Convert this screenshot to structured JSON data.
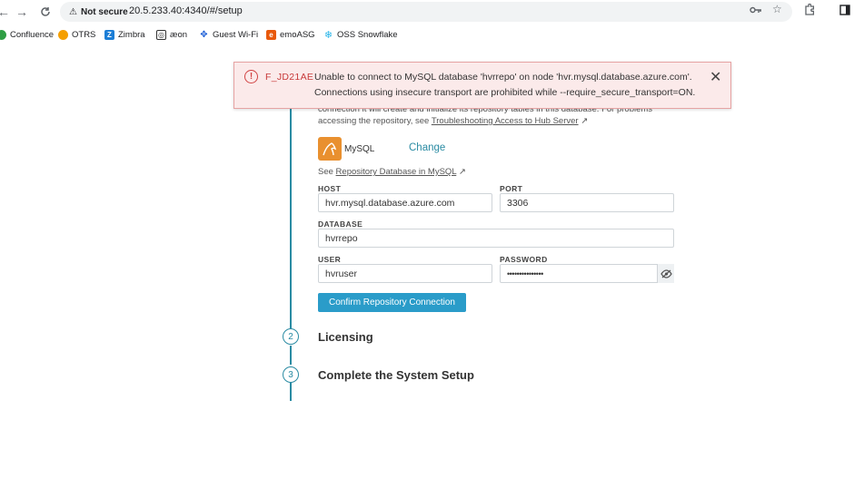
{
  "browser": {
    "not_secure_label": "Not secure",
    "url": "20.5.233.40:4340/#/setup"
  },
  "bookmarks": [
    {
      "label": "Confluence",
      "color": "#2f9e44"
    },
    {
      "label": "OTRS",
      "color": "#f59f00"
    },
    {
      "label": "Zimbra",
      "color": "#1c7ed6"
    },
    {
      "label": "æon",
      "color": "#333333"
    },
    {
      "label": "Guest Wi-Fi",
      "color": "#1c5ed6"
    },
    {
      "label": "emoASG",
      "color": "#e8590c"
    },
    {
      "label": "OSS Snowflake",
      "color": "#29b5e8"
    }
  ],
  "error": {
    "code": "F_JD21AE",
    "line1": "Unable to connect to MySQL database 'hvrrepo' on node 'hvr.mysql.database.azure.com'.",
    "line2": "Connections using insecure transport are prohibited while --require_secure_transport=ON."
  },
  "repository": {
    "description_line1": "connection it will create and initialize its repository tables in this database. For problems",
    "description_prefix": "accessing the repository, see ",
    "troubleshoot_link": "Troubleshooting Access to Hub Server",
    "db_type": "MySQL",
    "change_label": "Change",
    "see_prefix": "See ",
    "repo_db_link": "Repository Database in MySQL",
    "host_label": "HOST",
    "host_value": "hvr.mysql.database.azure.com",
    "port_label": "PORT",
    "port_value": "3306",
    "database_label": "DATABASE",
    "database_value": "hvrrepo",
    "user_label": "USER",
    "user_value": "hvruser",
    "password_label": "PASSWORD",
    "password_value": "•••••••••••••••",
    "confirm_label": "Confirm Repository Connection"
  },
  "steps": [
    {
      "number": "2",
      "title": "Licensing"
    },
    {
      "number": "3",
      "title": "Complete the System Setup"
    }
  ],
  "colors": {
    "accent": "#2a8ba3",
    "button": "#2a9cc9",
    "error": "#c83a3a",
    "mysql": "#e9902f"
  }
}
